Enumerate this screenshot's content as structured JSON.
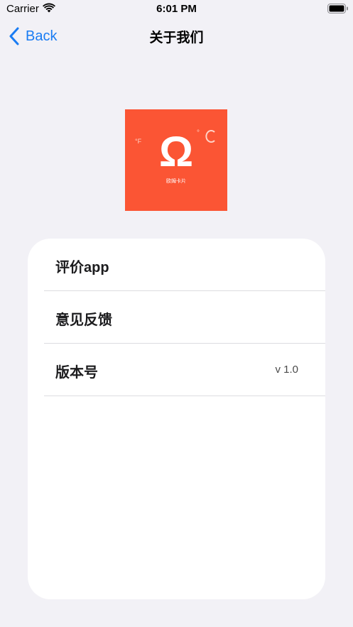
{
  "status_bar": {
    "carrier": "Carrier",
    "time": "6:01 PM",
    "wifi_icon": "wifi-icon",
    "battery_icon": "battery-icon"
  },
  "nav": {
    "back_label": "Back",
    "back_icon": "chevron-left-icon",
    "title": "关于我们",
    "accent_color": "#1a7cf3"
  },
  "logo": {
    "symbol": "Ω",
    "fahrenheit": "°F",
    "celsius": "°C",
    "caption": "欧姆卡片",
    "background_color": "#fb5534"
  },
  "menu": {
    "items": [
      {
        "label": "评价app",
        "value": ""
      },
      {
        "label": "意见反馈",
        "value": ""
      },
      {
        "label": "版本号",
        "value": "v 1.0"
      }
    ]
  }
}
